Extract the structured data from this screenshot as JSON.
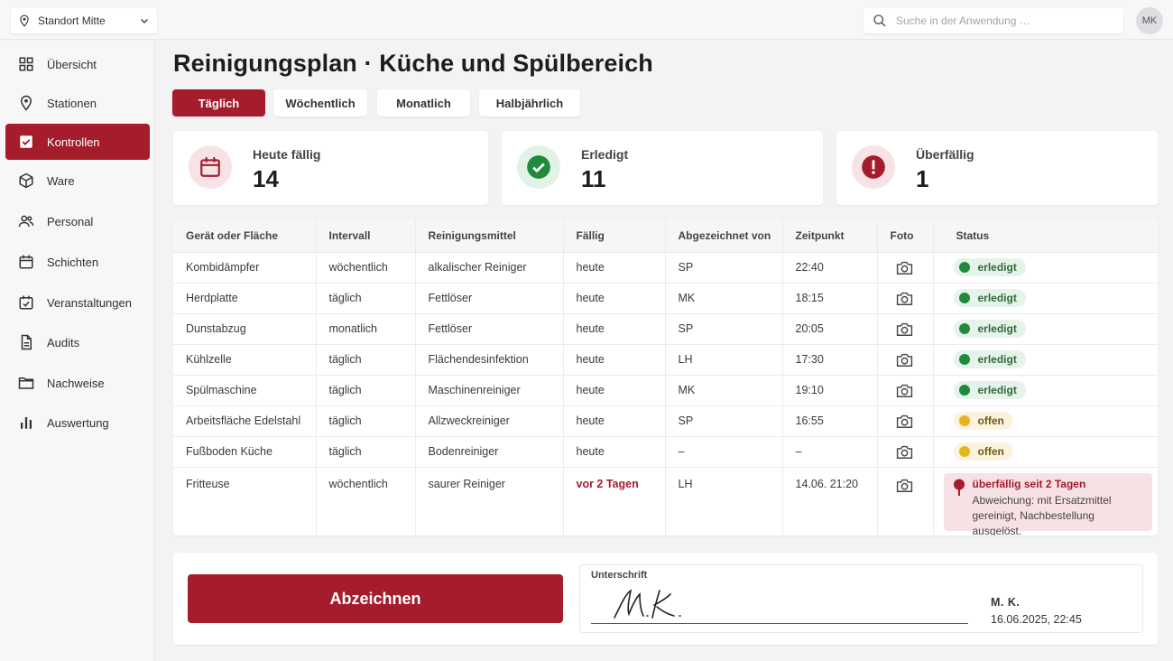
{
  "topbar": {
    "location": "Standort Mitte",
    "search_placeholder": "Suche in der Anwendung …",
    "avatar_initials": "MK"
  },
  "sidebar": {
    "items": [
      {
        "label": "Übersicht",
        "icon": "grid-icon"
      },
      {
        "label": "Stationen",
        "icon": "pin-icon"
      },
      {
        "label": "Kontrollen",
        "icon": "checkbox-icon",
        "active": true
      },
      {
        "label": "Ware",
        "icon": "box-icon"
      },
      {
        "label": "Personal",
        "icon": "people-icon"
      },
      {
        "label": "Schichten",
        "icon": "calendar-icon"
      },
      {
        "label": "Veranstaltungen",
        "icon": "calendar-check-icon"
      },
      {
        "label": "Audits",
        "icon": "document-icon"
      },
      {
        "label": "Nachweise",
        "icon": "folder-icon"
      },
      {
        "label": "Auswertung",
        "icon": "bar-chart-icon"
      }
    ]
  },
  "page": {
    "title": "Reinigungsplan · Küche und Spülbereich",
    "tabs": [
      "Täglich",
      "Wöchentlich",
      "Monatlich",
      "Halbjährlich"
    ],
    "active_tab": "Täglich"
  },
  "stats": [
    {
      "label": "Heute fällig",
      "value": "14",
      "icon": "calendar-icon"
    },
    {
      "label": "Erledigt",
      "value": "11",
      "icon": "check-circle-icon"
    },
    {
      "label": "Überfällig",
      "value": "1",
      "icon": "alert-circle-icon"
    }
  ],
  "table": {
    "headers": [
      "Gerät oder Fläche",
      "Intervall",
      "Reinigungsmittel",
      "Fällig",
      "Abgezeichnet von",
      "Zeitpunkt",
      "Foto",
      "Status"
    ],
    "rows": [
      {
        "item": "Kombidämpfer",
        "interval": "wöchentlich",
        "agent": "alkalischer Reiniger",
        "due": "heute",
        "signed_by": "SP",
        "time": "22:40",
        "status": "erledigt"
      },
      {
        "item": "Herdplatte",
        "interval": "täglich",
        "agent": "Fettlöser",
        "due": "heute",
        "signed_by": "MK",
        "time": "18:15",
        "status": "erledigt"
      },
      {
        "item": "Dunstabzug",
        "interval": "monatlich",
        "agent": "Fettlöser",
        "due": "heute",
        "signed_by": "SP",
        "time": "20:05",
        "status": "erledigt"
      },
      {
        "item": "Kühlzelle",
        "interval": "täglich",
        "agent": "Flächendesinfektion",
        "due": "heute",
        "signed_by": "LH",
        "time": "17:30",
        "status": "erledigt"
      },
      {
        "item": "Spülmaschine",
        "interval": "täglich",
        "agent": "Maschinenreiniger",
        "due": "heute",
        "signed_by": "MK",
        "time": "19:10",
        "status": "erledigt"
      },
      {
        "item": "Arbeitsfläche Edelstahl",
        "interval": "täglich",
        "agent": "Allzweckreiniger",
        "due": "heute",
        "signed_by": "SP",
        "time": "16:55",
        "status": "offen"
      },
      {
        "item": "Fußboden Küche",
        "interval": "täglich",
        "agent": "Bodenreiniger",
        "due": "heute",
        "signed_by": "–",
        "time": "–",
        "status": "offen"
      },
      {
        "item": "Fritteuse",
        "interval": "wöchentlich",
        "agent": "saurer Reiniger",
        "due": "vor 2 Tagen",
        "signed_by": "LH",
        "time": "14.06. 21:20",
        "status": "überfällig seit 2 Tagen",
        "note": "Abweichung: mit Ersatzmittel gereinigt, Nachbestellung ausgelöst."
      }
    ]
  },
  "footer": {
    "sign_button": "Abzeichnen",
    "signature_label": "Unterschrift",
    "signer": "M. K.",
    "signed_at": "16.06.2025, 22:45"
  },
  "colors": {
    "accent": "#a51c2c",
    "done": "#1f8a3b",
    "open": "#e8b321",
    "overdue_bg": "#f8e1e4"
  }
}
